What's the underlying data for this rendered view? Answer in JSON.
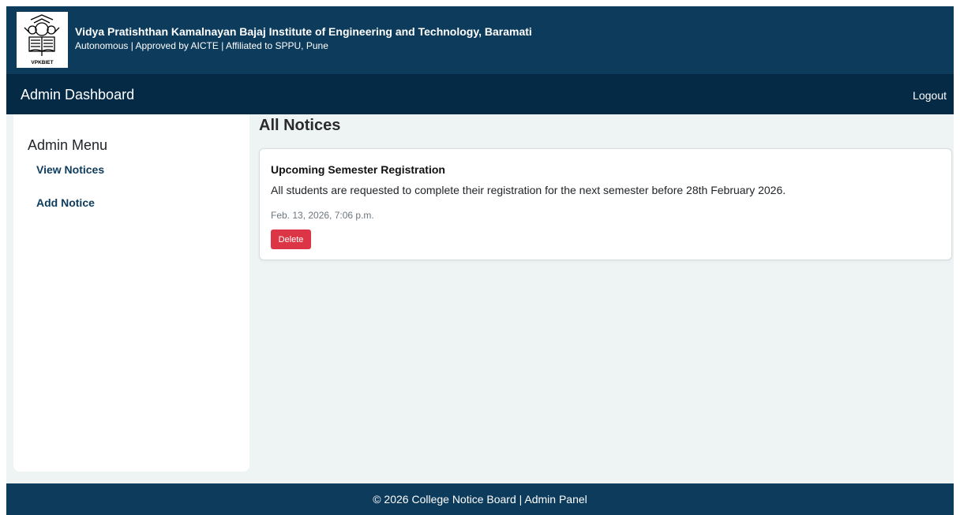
{
  "header": {
    "college_name": "Vidya Pratishthan Kamalnayan Bajaj Institute of Engineering and Technology, Baramati",
    "college_subtitle": "Autonomous | Approved by AICTE | Affiliated to SPPU, Pune",
    "logo_text": "VPKBIET"
  },
  "navbar": {
    "brand": "Admin Dashboard",
    "logout_label": "Logout"
  },
  "sidebar": {
    "title": "Admin Menu",
    "items": [
      {
        "label": "View Notices"
      },
      {
        "label": "Add Notice"
      }
    ]
  },
  "main": {
    "title": "All Notices",
    "notices": [
      {
        "title": "Upcoming Semester Registration",
        "body": "All students are requested to complete their registration for the next semester before 28th February 2026.",
        "date": "Feb. 13, 2026, 7:06 p.m.",
        "delete_label": "Delete"
      }
    ]
  },
  "footer": {
    "text": "© 2026 College Notice Board | Admin Panel"
  },
  "colors": {
    "header": "#0d3b5c",
    "navbar": "#052a45",
    "delete": "#dc3545",
    "background": "#eef3f3"
  }
}
